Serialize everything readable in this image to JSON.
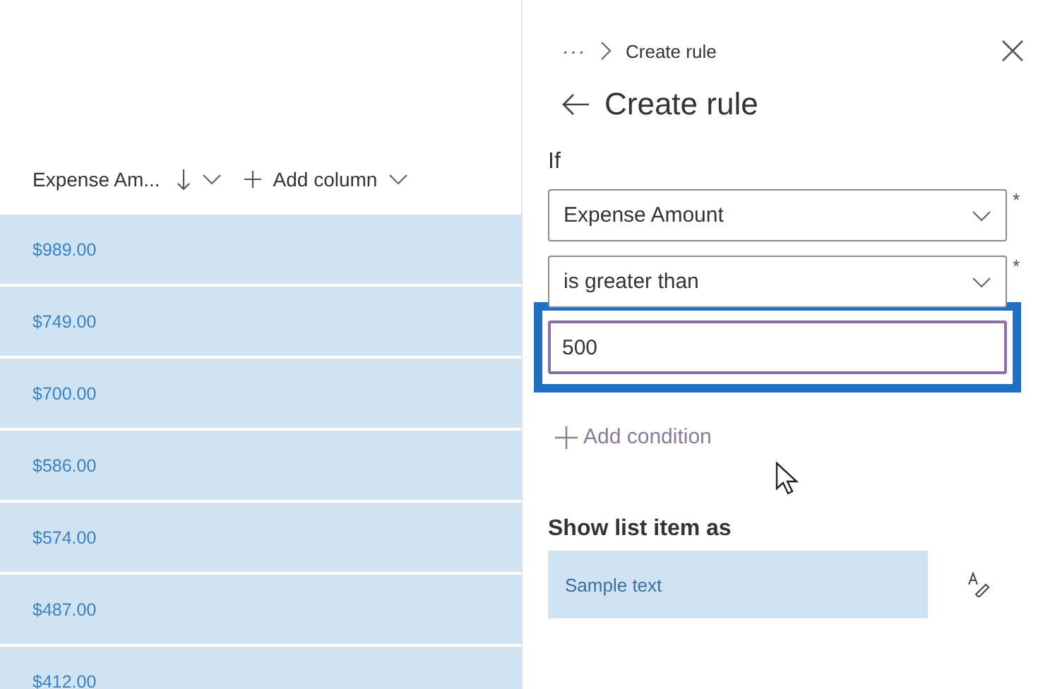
{
  "list": {
    "columns": [
      {
        "label": "Expense Am...",
        "sorted_descending": true,
        "has_menu": true
      },
      {
        "label": "Add column",
        "has_menu": true,
        "kind": "add"
      }
    ],
    "rows": [
      {
        "amount": "$989.00",
        "selected": true
      },
      {
        "amount": "$749.00",
        "selected": true
      },
      {
        "amount": "$700.00",
        "selected": true
      },
      {
        "amount": "$586.00",
        "selected": true
      },
      {
        "amount": "$574.00",
        "selected": true
      },
      {
        "amount": "$487.00",
        "selected": true
      },
      {
        "amount": "$412.00",
        "selected": true
      }
    ]
  },
  "panel": {
    "breadcrumb": {
      "more": "···",
      "current": "Create rule"
    },
    "title": "Create rule",
    "if_label": "If",
    "conditions": [
      {
        "kind": "dropdown",
        "value": "Expense Amount",
        "required_mark": "*"
      },
      {
        "kind": "dropdown",
        "value": "is greater than",
        "required_mark": "*"
      },
      {
        "kind": "text",
        "value": "500",
        "highlighted": true
      }
    ],
    "add_condition": "Add condition",
    "show_as_label": "Show list item as",
    "sample": "Sample text"
  }
}
